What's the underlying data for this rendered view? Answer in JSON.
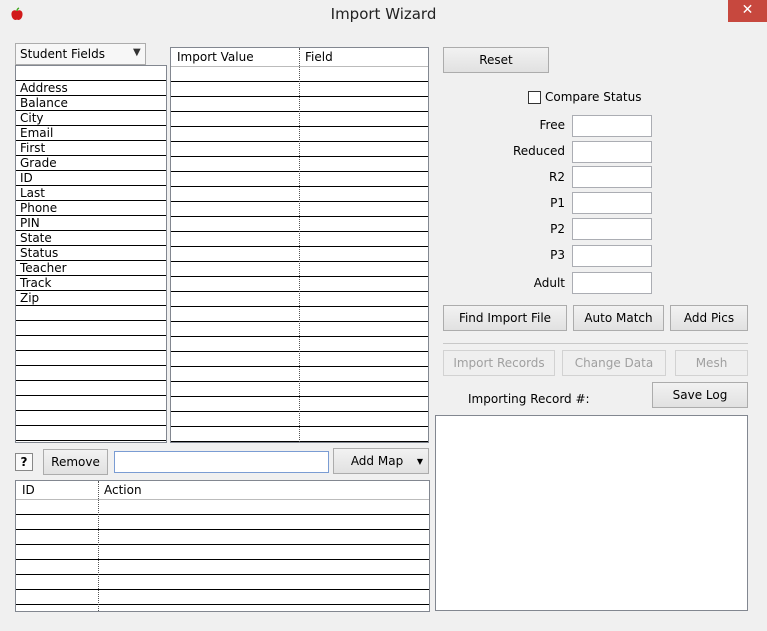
{
  "window": {
    "title": "Import Wizard",
    "close_label": "✕",
    "app_icon": "apple-icon"
  },
  "fields_panel": {
    "dropdown_label": "Student Fields",
    "items": [
      "Address",
      "Balance",
      "City",
      "Email",
      "First",
      "Grade",
      "ID",
      "Last",
      "Phone",
      "PIN",
      "State",
      "Status",
      "Teacher",
      "Track",
      "Zip"
    ]
  },
  "import_grid": {
    "columns": [
      "Import Value",
      "Field"
    ]
  },
  "buttons": {
    "reset": "Reset",
    "find_import_file": "Find Import File",
    "auto_match": "Auto Match",
    "add_pics": "Add Pics",
    "import_records": "Import Records",
    "change_data": "Change Data",
    "mesh": "Mesh",
    "save_log": "Save Log",
    "remove": "Remove",
    "add_map": "Add Map",
    "help": "?"
  },
  "compare_status": {
    "label": "Compare Status",
    "checked": false
  },
  "status_fields": [
    {
      "label": "Free",
      "value": ""
    },
    {
      "label": "Reduced",
      "value": ""
    },
    {
      "label": "R2",
      "value": ""
    },
    {
      "label": "P1",
      "value": ""
    },
    {
      "label": "P2",
      "value": ""
    },
    {
      "label": "P3",
      "value": ""
    },
    {
      "label": "Adult",
      "value": ""
    }
  ],
  "importing_record_label": "Importing Record #:",
  "map_search": {
    "value": ""
  },
  "action_grid": {
    "columns": [
      "ID",
      "Action"
    ]
  },
  "colors": {
    "close_button": "#c7483e",
    "window_bg": "#f0f0f0",
    "icon_red": "#d11a1a"
  }
}
